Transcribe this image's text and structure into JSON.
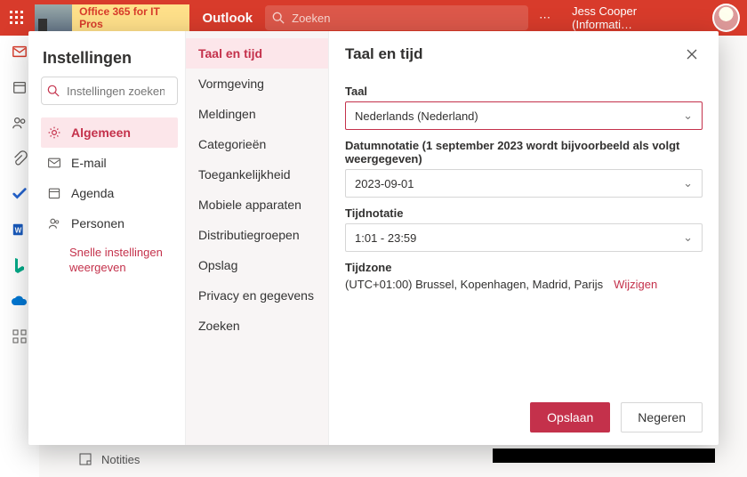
{
  "header": {
    "tenant_label": "Office 365 for IT Pros",
    "app_name": "Outlook",
    "search_placeholder": "Zoeken",
    "user_name": "Jess Cooper (Informati…"
  },
  "rail_icons": [
    "mail",
    "calendar",
    "people",
    "attach",
    "todo",
    "word",
    "bing",
    "onedrive",
    "apps"
  ],
  "backdrop": {
    "notes_label": "Notities"
  },
  "settings": {
    "title": "Instellingen",
    "search_placeholder": "Instellingen zoeken",
    "categories": [
      {
        "icon": "gear",
        "label": "Algemeen"
      },
      {
        "icon": "mail",
        "label": "E-mail"
      },
      {
        "icon": "calendar",
        "label": "Agenda"
      },
      {
        "icon": "people",
        "label": "Personen"
      }
    ],
    "quick_link": "Snelle instellingen weergeven"
  },
  "subsettings": [
    "Taal en tijd",
    "Vormgeving",
    "Meldingen",
    "Categorieën",
    "Toegankelijkheid",
    "Mobiele apparaten",
    "Distributiegroepen",
    "Opslag",
    "Privacy en gegevens",
    "Zoeken"
  ],
  "panel": {
    "title": "Taal en tijd",
    "language_label": "Taal",
    "language_value": "Nederlands (Nederland)",
    "dateformat_label": "Datumnotatie (1 september 2023 wordt bijvoorbeeld als volgt weergegeven)",
    "dateformat_value": "2023-09-01",
    "timeformat_label": "Tijdnotatie",
    "timeformat_value": "1:01 - 23:59",
    "timezone_label": "Tijdzone",
    "timezone_value": "(UTC+01:00) Brussel, Kopenhagen, Madrid, Parijs",
    "timezone_change": "Wijzigen",
    "save": "Opslaan",
    "discard": "Negeren"
  }
}
